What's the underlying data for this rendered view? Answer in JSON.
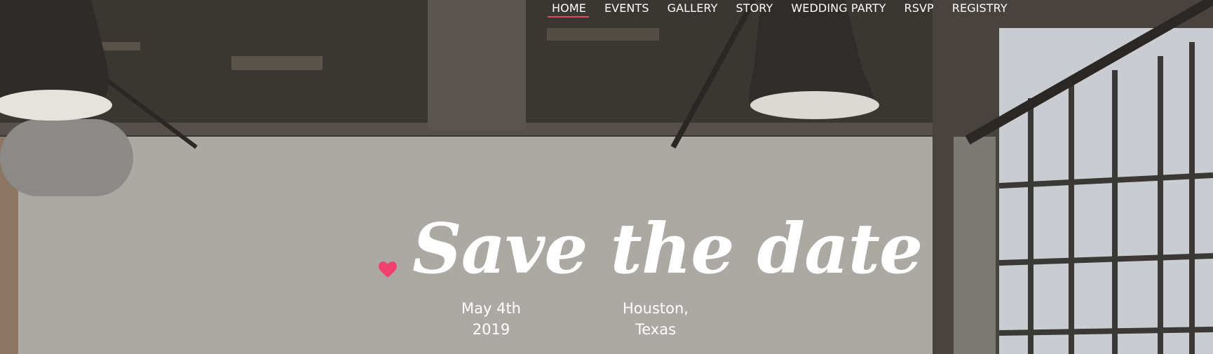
{
  "nav": {
    "items": [
      {
        "label": "HOME",
        "active": true
      },
      {
        "label": "EVENTS"
      },
      {
        "label": "GALLERY"
      },
      {
        "label": "STORY"
      },
      {
        "label": "WEDDING PARTY"
      },
      {
        "label": "RSVP"
      },
      {
        "label": "REGISTRY"
      }
    ],
    "active_underline_color": "#e04a6a"
  },
  "hero": {
    "title": "Save the date",
    "heart_color": "#f0416c",
    "date": {
      "line1": "May 4th",
      "line2": "2019"
    },
    "location": {
      "line1": "Houston,",
      "line2": "Texas"
    }
  }
}
